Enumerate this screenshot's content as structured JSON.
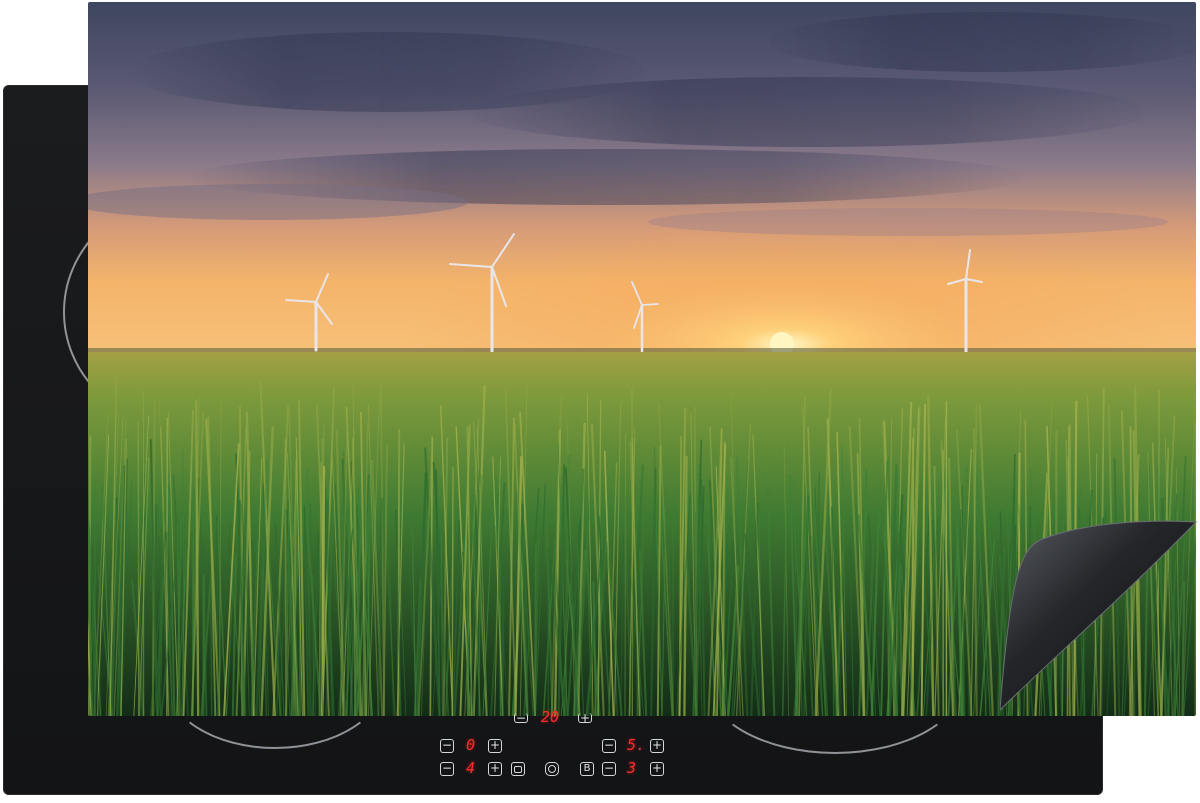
{
  "scene": {
    "subject": "wheat-field-wind-turbines-sunset",
    "colors": {
      "sky_top": "#3f4660",
      "sky_mid": "#7a6f86",
      "horizon": "#f4b46a",
      "sun": "#fff2b0",
      "field_light": "#7a9a3a",
      "field_dark": "#17351a",
      "hob": "#151618"
    }
  },
  "controls": {
    "top_display": "20",
    "left_display_top": "0",
    "left_display_bottom": "4",
    "right_display_top": "5.",
    "right_display_bottom": "3",
    "minus": "−",
    "plus": "+",
    "b_key": "B"
  }
}
